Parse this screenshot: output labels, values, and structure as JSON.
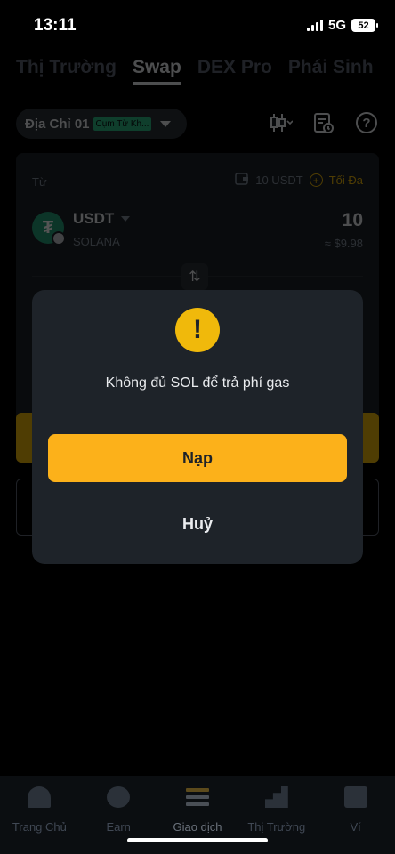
{
  "status_bar": {
    "time": "13:11",
    "network": "5G",
    "battery": "52"
  },
  "top_tabs": [
    {
      "label": "Thị Trường",
      "active": false
    },
    {
      "label": "Swap",
      "active": true
    },
    {
      "label": "DEX Pro",
      "active": false
    },
    {
      "label": "Phái Sinh",
      "active": false
    }
  ],
  "address": {
    "label": "Địa Chỉ 01",
    "tag": "Cụm Từ Kh..."
  },
  "icons": {
    "chart": "candlestick-icon",
    "history": "order-history-icon",
    "help": "help-icon"
  },
  "swap": {
    "from_label": "Từ",
    "balance": "10 USDT",
    "max_label": "Tối Đa",
    "token": {
      "symbol": "USDT",
      "logo_letter": "₮",
      "chain": "SOLANA"
    },
    "amount": "10",
    "amount_usd": "≈ $9.98"
  },
  "modal": {
    "icon": "warning-icon",
    "message": "Không đủ SOL để trả phí gas",
    "primary_label": "Nạp",
    "cancel_label": "Huỷ"
  },
  "bottom_nav": [
    {
      "label": "Trang Chủ",
      "icon": "home-icon"
    },
    {
      "label": "Earn",
      "icon": "earn-icon"
    },
    {
      "label": "Giao dịch",
      "icon": "trade-icon",
      "active": true
    },
    {
      "label": "Thị Trường",
      "icon": "market-icon"
    },
    {
      "label": "Ví",
      "icon": "wallet-icon"
    }
  ],
  "colors": {
    "accent": "#fcb11a",
    "background": "#000000",
    "card": "#1e2329",
    "usdt": "#26a17b"
  }
}
